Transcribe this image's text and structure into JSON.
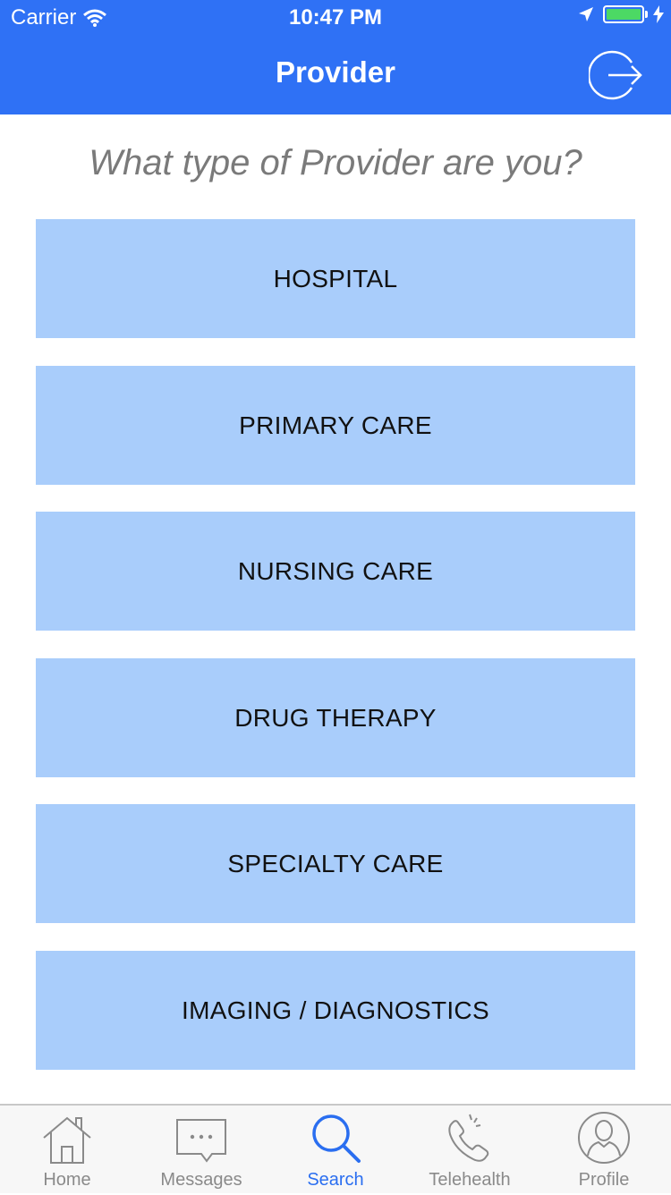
{
  "status_bar": {
    "carrier": "Carrier",
    "time": "10:47 PM"
  },
  "nav": {
    "title": "Provider",
    "logout_icon": "logout-icon"
  },
  "question": "What type of Provider are you?",
  "options": [
    {
      "label": "HOSPITAL"
    },
    {
      "label": "PRIMARY CARE"
    },
    {
      "label": "NURSING CARE"
    },
    {
      "label": "DRUG THERAPY"
    },
    {
      "label": "SPECIALTY CARE"
    },
    {
      "label": "IMAGING / DIAGNOSTICS"
    }
  ],
  "tabs": [
    {
      "label": "Home",
      "icon": "house-icon",
      "active": false
    },
    {
      "label": "Messages",
      "icon": "message-icon",
      "active": false
    },
    {
      "label": "Search",
      "icon": "search-icon",
      "active": true
    },
    {
      "label": "Telehealth",
      "icon": "phone-icon",
      "active": false
    },
    {
      "label": "Profile",
      "icon": "profile-icon",
      "active": false
    }
  ],
  "colors": {
    "header": "#2f71f5",
    "option_background": "#a9cdfb",
    "active_tab": "#2a6ef0",
    "inactive_tab": "#8a8a8a"
  }
}
